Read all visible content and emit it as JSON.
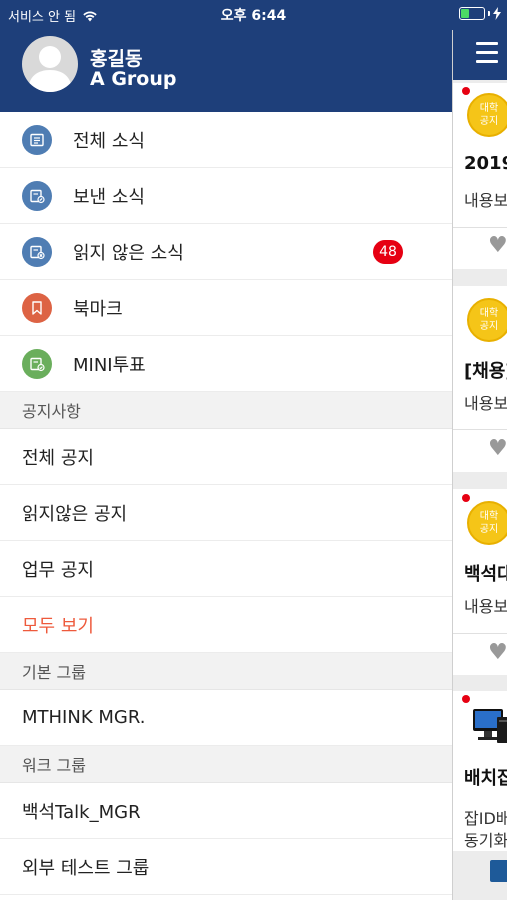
{
  "status_bar": {
    "carrier": "서비스 안 됨",
    "time": "오후 6:44",
    "battery_level": 0.35,
    "colors": {
      "battery": "#4cd964"
    }
  },
  "header": {
    "user_name": "홍길동",
    "group_name": "A Group"
  },
  "menu": [
    {
      "label": "전체 소식",
      "icon": "news-list-icon",
      "color": "#4f7db3"
    },
    {
      "label": "보낸 소식",
      "icon": "sent-news-icon",
      "color": "#4f7db3"
    },
    {
      "label": "읽지 않은 소식",
      "icon": "unread-news-icon",
      "color": "#4f7db3",
      "badge": "48"
    },
    {
      "label": "북마크",
      "icon": "bookmark-icon",
      "color": "#dd6344"
    },
    {
      "label": "MINI투표",
      "icon": "vote-icon",
      "color": "#6aae5c"
    }
  ],
  "notice_section": {
    "title": "공지사항",
    "items": [
      "전체 공지",
      "읽지않은 공지",
      "업무 공지"
    ],
    "view_all": "모두 보기"
  },
  "basic_group": {
    "title": "기본 그룹",
    "items": [
      "MTHINK MGR."
    ]
  },
  "work_group": {
    "title": "워크 그룹",
    "items": [
      "백석Talk_MGR",
      "외부 테스트 그룹"
    ]
  },
  "background": {
    "cards": [
      {
        "logo_text": "대학\n공지",
        "title": "2019",
        "body": "내용보"
      },
      {
        "logo_text": "대학\n공지",
        "title": "[채용]",
        "body": "내용보"
      },
      {
        "logo_text": "대학\n공지",
        "title": "백석대",
        "body": "내용보"
      },
      {
        "title": "배치잡",
        "body_line1": "잡ID배",
        "body_line2": "동기화"
      }
    ]
  },
  "colors": {
    "header": "#1e3f7a",
    "accent": "#ee5a3c",
    "badge": "#e60012"
  }
}
